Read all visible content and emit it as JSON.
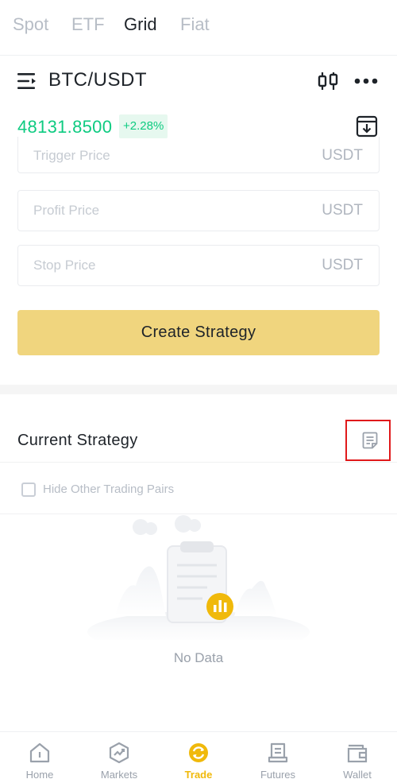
{
  "top_tabs": [
    {
      "label": "Spot",
      "active": false
    },
    {
      "label": "ETF",
      "active": false
    },
    {
      "label": "Grid",
      "active": true
    },
    {
      "label": "Fiat",
      "active": false
    }
  ],
  "pair": {
    "name": "BTC/USDT",
    "price": "48131.8500",
    "change": "+2.28%",
    "icons": [
      "menu-icon",
      "candlestick-icon",
      "more-icon",
      "download-icon"
    ]
  },
  "form": {
    "trigger_price": {
      "placeholder": "Trigger Price",
      "unit": "USDT"
    },
    "profit_price": {
      "placeholder": "Profit Price",
      "unit": "USDT"
    },
    "stop_price": {
      "placeholder": "Stop Price",
      "unit": "USDT"
    },
    "create_button": "Create Strategy"
  },
  "current_strategy": {
    "title": "Current Strategy",
    "hide_other_pairs_label": "Hide Other Trading Pairs",
    "hide_other_pairs_checked": false,
    "empty_text": "No Data"
  },
  "bottom_nav": [
    {
      "label": "Home",
      "icon": "home-icon",
      "active": false
    },
    {
      "label": "Markets",
      "icon": "markets-icon",
      "active": false
    },
    {
      "label": "Trade",
      "icon": "trade-icon",
      "active": true
    },
    {
      "label": "Futures",
      "icon": "futures-icon",
      "active": false
    },
    {
      "label": "Wallet",
      "icon": "wallet-icon",
      "active": false
    }
  ],
  "colors": {
    "accent_yellow": "#F0D57E",
    "active_nav": "#F0B90B",
    "positive_green": "#0ECB81",
    "highlight_box": "#E0191B"
  }
}
